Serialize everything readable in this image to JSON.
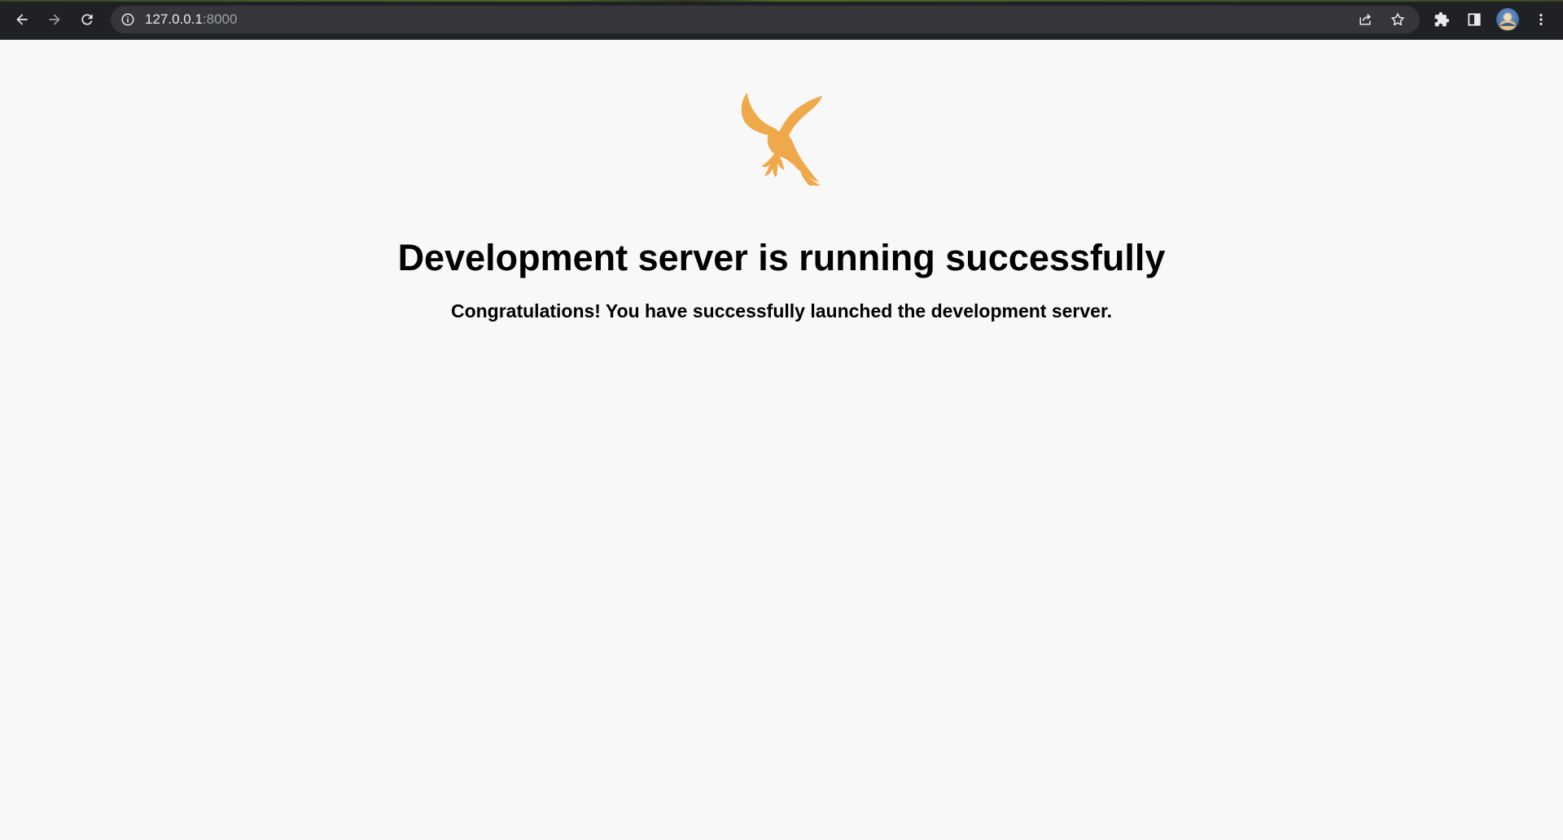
{
  "browser": {
    "url_host": "127.0.0.1",
    "url_port": ":8000",
    "icons": {
      "back": "arrow-left-icon",
      "forward": "arrow-right-icon",
      "reload": "reload-icon",
      "site_info": "info-icon",
      "share": "share-icon",
      "bookmark": "star-icon",
      "extensions": "puzzle-icon",
      "side_panel": "side-panel-icon",
      "menu": "kebab-menu-icon"
    },
    "colors": {
      "toolbar_bg": "#202124",
      "omnibox_bg": "#35363a",
      "icon": "#e8eaed",
      "icon_disabled": "#9aa0a6"
    }
  },
  "page": {
    "logo": "eagle-logo",
    "logo_color": "#f0a94a",
    "title": "Development server is running successfully",
    "subtitle": "Congratulations! You have successfully launched the development server.",
    "background": "#f8f8f8"
  }
}
